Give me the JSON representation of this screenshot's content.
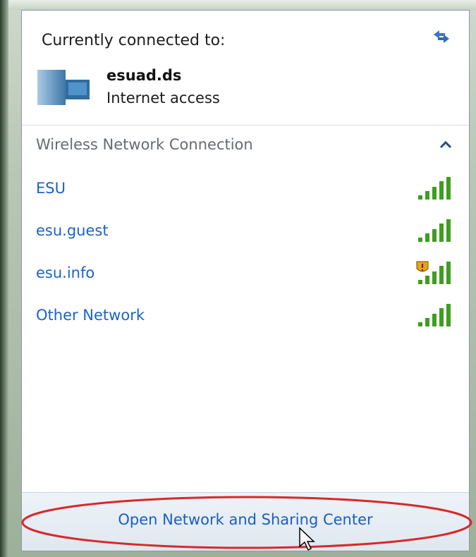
{
  "connected_section": {
    "title": "Currently connected to:",
    "network_name": "esuad.ds",
    "status": "Internet access",
    "refresh_icon": "refresh-icon",
    "network_icon": "network-computer-icon"
  },
  "wireless_section": {
    "title": "Wireless Network Connection",
    "collapse_icon": "chevron-up-icon",
    "networks": [
      {
        "name": "ESU",
        "signal_bars": 5,
        "security_warning": false
      },
      {
        "name": "esu.guest",
        "signal_bars": 5,
        "security_warning": false
      },
      {
        "name": "esu.info",
        "signal_bars": 5,
        "security_warning": true
      },
      {
        "name": "Other Network",
        "signal_bars": 5,
        "security_warning": false
      }
    ]
  },
  "footer": {
    "link_label": "Open Network and Sharing Center"
  },
  "colors": {
    "link": "#1a63c9",
    "signal": "#3f9d1f",
    "highlight": "#d62a2a"
  }
}
